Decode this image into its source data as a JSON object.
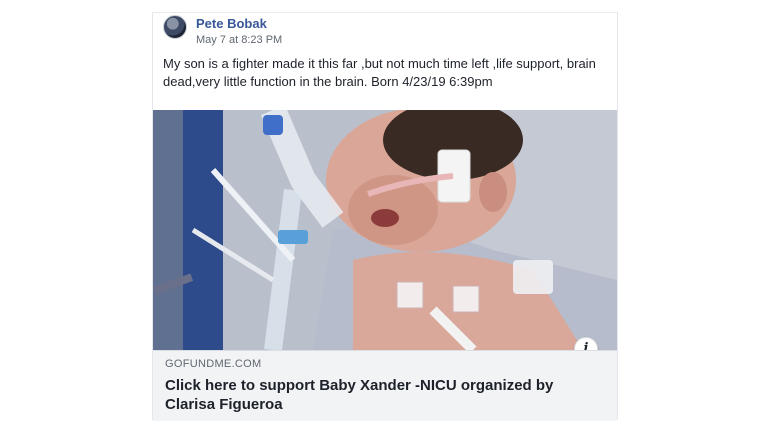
{
  "post": {
    "author": "Pete Bobak",
    "timestamp": "May 7 at 8:23 PM",
    "text": "My son is a fighter made it this far ,but not much time left ,life support, brain dead,very little function in the brain. Born 4/23/19 6:39pm"
  },
  "link_preview": {
    "domain": "GOFUNDME.COM",
    "title": "Click here to support Baby Xander -NICU organized by Clarisa Figueroa",
    "info_icon_label": "i"
  },
  "colors": {
    "author_link": "#385898",
    "preview_background": "#f2f3f5",
    "text": "#1d2129",
    "secondary_text": "#606770"
  },
  "icons": [
    "avatar",
    "info-icon"
  ]
}
